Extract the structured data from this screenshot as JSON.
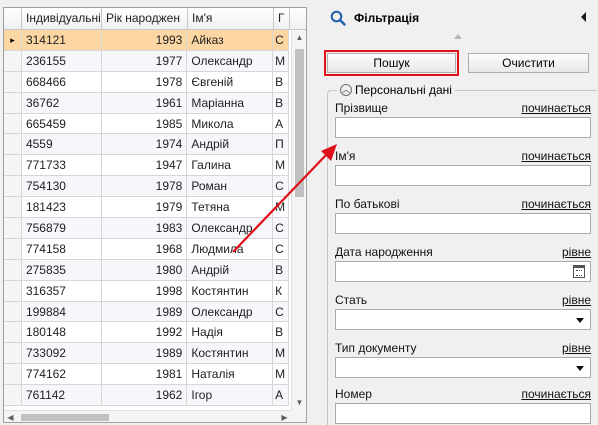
{
  "grid": {
    "columns": [
      "Індивідуальні",
      "Рік народжен",
      "Ім'я",
      "Г"
    ],
    "rows": [
      {
        "id": "314121",
        "year": "1993",
        "name": "Айказ",
        "extra": "С"
      },
      {
        "id": "236155",
        "year": "1977",
        "name": "Олександр",
        "extra": "М"
      },
      {
        "id": "668466",
        "year": "1978",
        "name": "Євгеній",
        "extra": "В"
      },
      {
        "id": "36762",
        "year": "1961",
        "name": "Маріанна",
        "extra": "В"
      },
      {
        "id": "665459",
        "year": "1985",
        "name": "Микола",
        "extra": "А"
      },
      {
        "id": "4559",
        "year": "1974",
        "name": "Андрій",
        "extra": "П"
      },
      {
        "id": "771733",
        "year": "1947",
        "name": "Галина",
        "extra": "М"
      },
      {
        "id": "754130",
        "year": "1978",
        "name": "Роман",
        "extra": "С"
      },
      {
        "id": "181423",
        "year": "1979",
        "name": "Тетяна",
        "extra": "М"
      },
      {
        "id": "756879",
        "year": "1983",
        "name": "Олександр",
        "extra": "С"
      },
      {
        "id": "774158",
        "year": "1968",
        "name": "Людмила",
        "extra": "С"
      },
      {
        "id": "275835",
        "year": "1980",
        "name": "Андрій",
        "extra": "В"
      },
      {
        "id": "316357",
        "year": "1998",
        "name": "Костянтин",
        "extra": "К"
      },
      {
        "id": "199884",
        "year": "1989",
        "name": "Олександр",
        "extra": "С"
      },
      {
        "id": "180148",
        "year": "1992",
        "name": "Надія",
        "extra": "В"
      },
      {
        "id": "733092",
        "year": "1989",
        "name": "Костянтин",
        "extra": "М"
      },
      {
        "id": "774162",
        "year": "1981",
        "name": "Наталія",
        "extra": "М"
      },
      {
        "id": "761142",
        "year": "1962",
        "name": "Ігор",
        "extra": "А"
      }
    ],
    "selected_row_indicator": "▸"
  },
  "panel": {
    "title": "Фільтрація",
    "search_button": "Пошук",
    "clear_button": "Очистити",
    "group_title": "Персональні дані",
    "fields": [
      {
        "label": "Прізвище",
        "op": "починається",
        "type": "text"
      },
      {
        "label": "Ім'я",
        "op": "починається",
        "type": "text"
      },
      {
        "label": "По батькові",
        "op": "починається",
        "type": "text"
      },
      {
        "label": "Дата народження",
        "op": "рівне",
        "type": "date"
      },
      {
        "label": "Стать",
        "op": "рівне",
        "type": "select"
      },
      {
        "label": "Тип документу",
        "op": "рівне",
        "type": "select"
      },
      {
        "label": "Номер",
        "op": "починається",
        "type": "text"
      }
    ]
  },
  "colors": {
    "selected_row": "#fcd6a3",
    "highlight": "#e0101a",
    "search_icon": "#1f5fa8"
  }
}
